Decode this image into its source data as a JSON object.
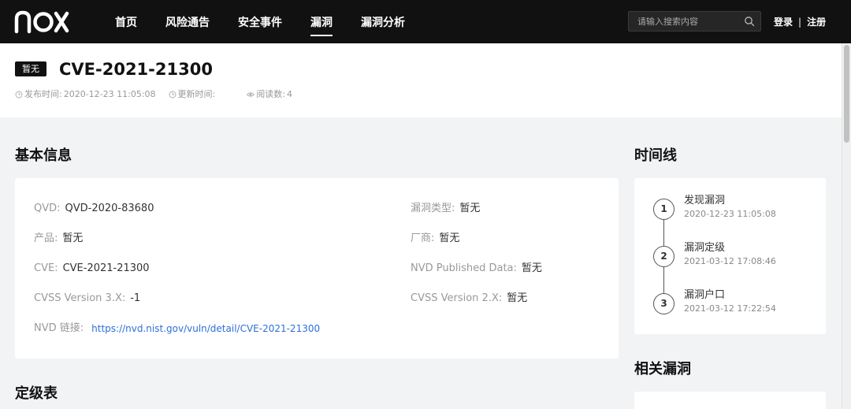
{
  "brand": {
    "logo_text": "nox"
  },
  "nav": {
    "items": [
      {
        "label": "首页",
        "active": false
      },
      {
        "label": "风险通告",
        "active": false
      },
      {
        "label": "安全事件",
        "active": false
      },
      {
        "label": "漏洞",
        "active": true
      },
      {
        "label": "漏洞分析",
        "active": false
      }
    ]
  },
  "search": {
    "placeholder": "请输入搜索内容",
    "icon": "search-icon"
  },
  "auth": {
    "login": "登录",
    "separator": "|",
    "register": "注册"
  },
  "header": {
    "badge": "暂无",
    "title": "CVE-2021-21300",
    "publish_label": "发布时间:",
    "publish_value": "2020-12-23 11:05:08",
    "update_label": "更新时间:",
    "update_value": "",
    "views_label": "阅读数:",
    "views_value": "4"
  },
  "sections": {
    "basic_info": "基本信息",
    "timeline": "时间线",
    "related": "相关漏洞",
    "grading": "定级表"
  },
  "basic_info": {
    "qvd_label": "QVD:",
    "qvd_value": "QVD-2020-83680",
    "vuln_type_label": "漏洞类型:",
    "vuln_type_value": "暂无",
    "product_label": "产品:",
    "product_value": "暂无",
    "vendor_label": "厂商:",
    "vendor_value": "暂无",
    "cve_label": "CVE:",
    "cve_value": "CVE-2021-21300",
    "nvd_pub_label": "NVD Published Data:",
    "nvd_pub_value": "暂无",
    "cvss3_label": "CVSS Version 3.X:",
    "cvss3_value": "-1",
    "cvss2_label": "CVSS Version 2.X:",
    "cvss2_value": "暂无",
    "nvd_link_label": "NVD 链接:",
    "nvd_link_value": "https://nvd.nist.gov/vuln/detail/CVE-2021-21300"
  },
  "timeline": [
    {
      "step": "1",
      "title": "发现漏洞",
      "date": "2020-12-23 11:05:08"
    },
    {
      "step": "2",
      "title": "漏洞定级",
      "date": "2021-03-12 17:08:46"
    },
    {
      "step": "3",
      "title": "漏洞户口",
      "date": "2021-03-12 17:22:54"
    }
  ]
}
